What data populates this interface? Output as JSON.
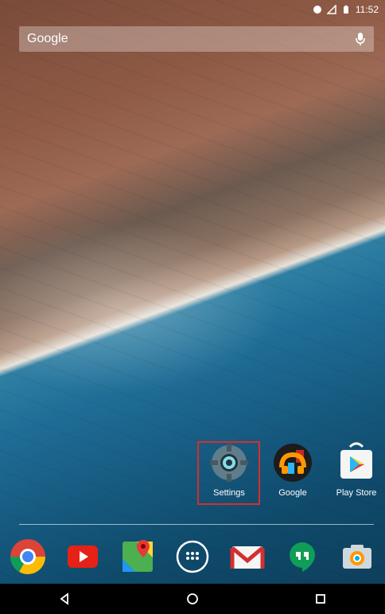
{
  "status_bar": {
    "time": "11:52",
    "icons": [
      "wifi-icon",
      "signal-icon",
      "battery-icon"
    ]
  },
  "search": {
    "label": "Google",
    "mic_icon": "mic-icon"
  },
  "apps": [
    {
      "name": "settings",
      "label": "Settings",
      "icon": "settings-gear-icon"
    },
    {
      "name": "google",
      "label": "Google",
      "icon": "google-icon"
    },
    {
      "name": "play-store",
      "label": "Play Store",
      "icon": "play-store-icon"
    }
  ],
  "dock": [
    {
      "name": "chrome",
      "icon": "chrome-icon"
    },
    {
      "name": "youtube",
      "icon": "youtube-icon"
    },
    {
      "name": "maps",
      "icon": "maps-icon"
    },
    {
      "name": "app-drawer",
      "icon": "apps-grid-icon"
    },
    {
      "name": "gmail",
      "icon": "gmail-icon"
    },
    {
      "name": "hangouts",
      "icon": "hangouts-icon"
    },
    {
      "name": "camera",
      "icon": "camera-icon"
    }
  ],
  "nav": {
    "back_icon": "back-icon",
    "home_icon": "home-icon",
    "recents_icon": "recents-icon"
  },
  "colors": {
    "highlight": "#d32f2f"
  }
}
